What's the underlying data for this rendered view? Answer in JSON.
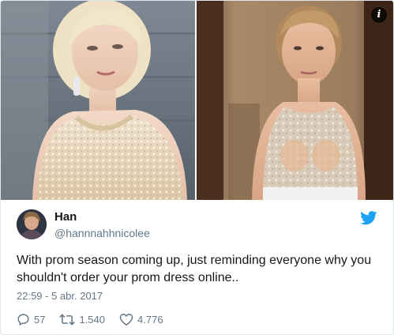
{
  "tweet": {
    "display_name": "Han",
    "handle": "@hannnahhnicolee",
    "text": "With prom season coming up, just reminding everyone why you shouldn't order your prom dress online..",
    "timestamp": "22:59 - 5 abr. 2017",
    "replies": "57",
    "retweets": "1.540",
    "likes": "4.776"
  },
  "icons": {
    "info": "i",
    "reply": "reply-icon",
    "retweet": "retweet-icon",
    "like": "heart-icon",
    "brand": "twitter-bird-icon"
  },
  "colors": {
    "brand": "#1da1f2",
    "text": "#14171a",
    "muted": "#657786",
    "border": "#e1e8ed"
  }
}
